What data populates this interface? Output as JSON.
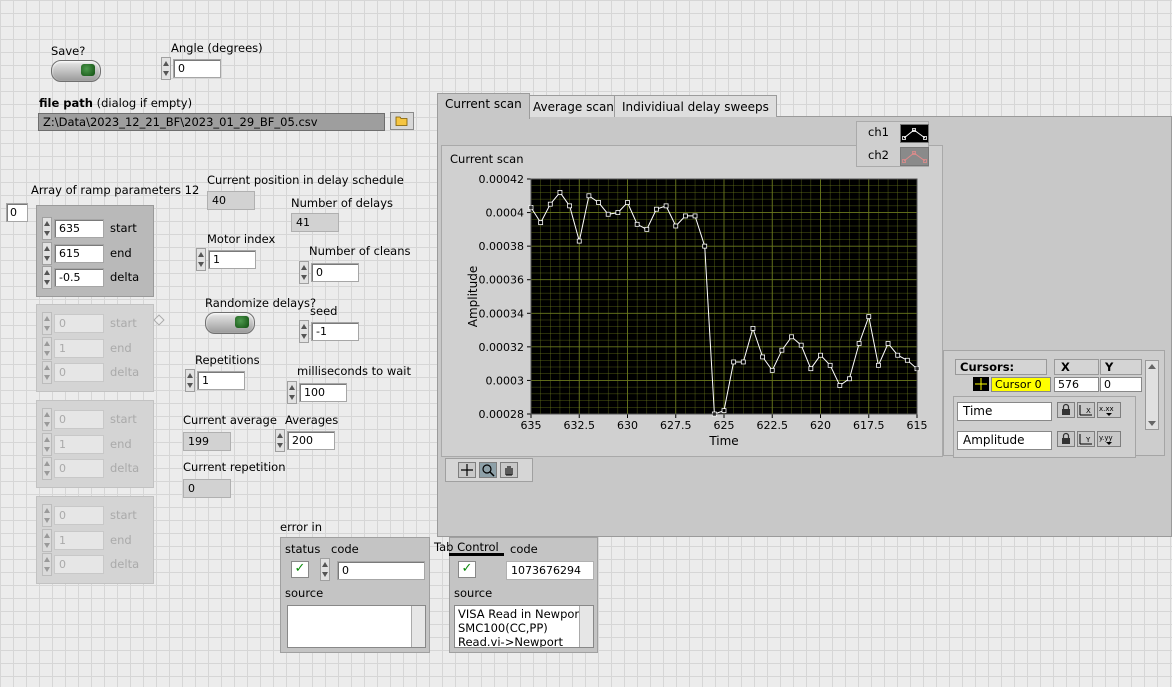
{
  "save": {
    "label": "Save?"
  },
  "angle": {
    "label": "Angle (degrees)",
    "value": "0"
  },
  "file_path": {
    "label_bold": "file path",
    "label_rest": " (dialog if empty)",
    "value": "Z:\\Data\\2023_12_21_BF\\2023_01_29_BF_05.csv"
  },
  "array": {
    "label": "Array of ramp parameters 12",
    "index": "0",
    "rows": [
      {
        "start": "635",
        "end": "615",
        "delta": "-0.5"
      },
      {
        "start": "0",
        "end": "1",
        "delta": "0"
      },
      {
        "start": "0",
        "end": "1",
        "delta": "0"
      },
      {
        "start": "0",
        "end": "1",
        "delta": "0"
      }
    ],
    "start_label": "start",
    "end_label": "end",
    "delta_label": "delta"
  },
  "current_position": {
    "label": "Current position in delay schedule",
    "value": "40"
  },
  "num_delays": {
    "label": "Number of delays",
    "value": "41"
  },
  "motor_index": {
    "label": "Motor index",
    "value": "1"
  },
  "num_cleans": {
    "label": "Number of cleans",
    "value": "0"
  },
  "randomize": {
    "label": "Randomize delays?"
  },
  "seed": {
    "label": "seed",
    "value": "-1"
  },
  "repetitions": {
    "label": "Repetitions",
    "value": "1"
  },
  "ms_wait": {
    "label": "milliseconds to wait",
    "value": "100"
  },
  "current_average": {
    "label": "Current average",
    "value": "199"
  },
  "averages": {
    "label": "Averages",
    "value": "200"
  },
  "current_repetition": {
    "label": "Current repetition",
    "value": "0"
  },
  "tabs": [
    {
      "label": "Current scan",
      "active": true
    },
    {
      "label": "Average scan",
      "active": false
    },
    {
      "label": "Individiual delay sweeps",
      "active": false
    }
  ],
  "graph": {
    "legend": [
      {
        "name": "ch1"
      },
      {
        "name": "ch2"
      }
    ]
  },
  "chart_data": {
    "type": "line",
    "title": "Current scan",
    "xlabel": "Time",
    "ylabel": "Amplitude",
    "xlim": [
      635,
      615
    ],
    "ylim": [
      0.00028,
      0.00042
    ],
    "x_ticks": [
      "635",
      "632.5",
      "630",
      "627.5",
      "625",
      "622.5",
      "620",
      "617.5",
      "615"
    ],
    "y_ticks": [
      "0.00042",
      "0.0004",
      "0.00038",
      "0.00036",
      "0.00034",
      "0.00032",
      "0.0003",
      "0.00028"
    ],
    "grid": true,
    "series": [
      {
        "name": "ch1",
        "color": "#ffffff",
        "x": [
          635,
          634.5,
          634,
          633.5,
          633,
          632.5,
          632,
          631.5,
          631,
          630.5,
          630,
          629.5,
          629,
          628.5,
          628,
          627.5,
          627,
          626.5,
          626,
          625.5,
          625,
          624.5,
          624,
          623.5,
          623,
          622.5,
          622,
          621.5,
          621,
          620.5,
          620,
          619.5,
          619,
          618.5,
          618,
          617.5,
          617,
          616.5,
          616,
          615.5,
          615
        ],
        "y": [
          0.000403,
          0.000394,
          0.000405,
          0.000412,
          0.000404,
          0.000383,
          0.00041,
          0.000406,
          0.000399,
          0.0004,
          0.000406,
          0.000393,
          0.00039,
          0.000402,
          0.000404,
          0.000392,
          0.000398,
          0.000398,
          0.00038,
          0.00028,
          0.000282,
          0.000311,
          0.000311,
          0.000331,
          0.000314,
          0.000306,
          0.000318,
          0.000326,
          0.000321,
          0.000307,
          0.000315,
          0.000309,
          0.000297,
          0.000301,
          0.000322,
          0.000338,
          0.000309,
          0.000322,
          0.000315,
          0.000312,
          0.000307
        ]
      }
    ]
  },
  "graph_palette": {
    "background": "#000000",
    "grid": "#6b7a1e",
    "trace": "#ffffff"
  },
  "cursors": {
    "title": "Cursors:",
    "x_header": "X",
    "y_header": "Y",
    "rows": [
      {
        "name": "Cursor 0",
        "x": "576",
        "y": "0"
      }
    ],
    "x_axis_name": "Time",
    "y_axis_name": "Amplitude"
  },
  "error_in": {
    "label": "error in",
    "status_label": "status",
    "code_label": "code",
    "code_value": "0",
    "source_label": "source",
    "source_value": ""
  },
  "error_out": {
    "tab_control_label": "Tab Control",
    "code_label": "code",
    "code_value": "1073676294",
    "source_label": "source",
    "source_lines": [
      "VISA Read in Newport",
      "SMC100(CC,PP)",
      "Read.vi->Newport"
    ]
  }
}
